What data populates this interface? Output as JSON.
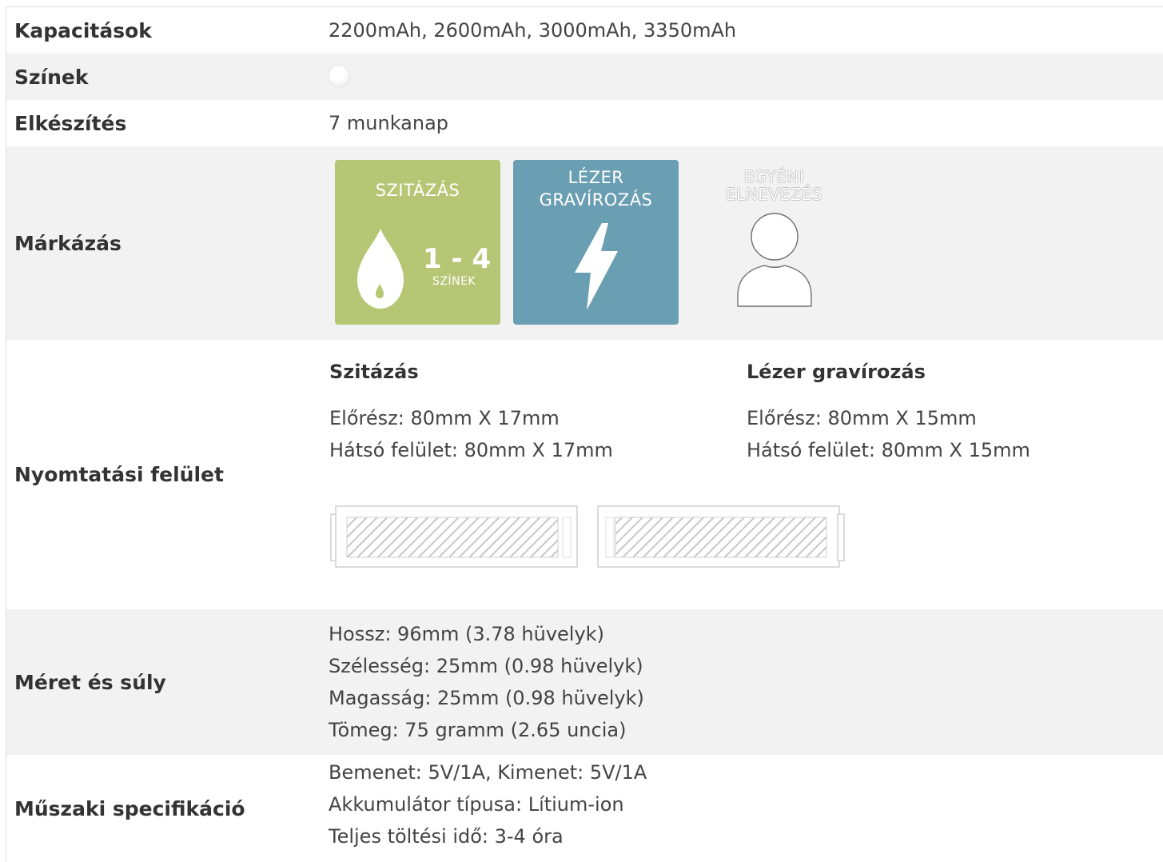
{
  "rows": {
    "capacity": {
      "label": "Kapacitások",
      "value": "2200mAh, 2600mAh, 3000mAh, 3350mAh"
    },
    "colors": {
      "label": "Színek",
      "swatch": "#ffffff"
    },
    "production": {
      "label": "Elkészítés",
      "value": "7 munkanap"
    },
    "branding": {
      "label": "Márkázás",
      "tiles": {
        "screen": {
          "title": "SZITÁZÁS",
          "count": "1 - 4",
          "count_label": "SZÍNEK",
          "color": "#b5c775",
          "icon": "drop-icon"
        },
        "laser": {
          "title_line1": "LÉZER",
          "title_line2": "GRAVÍROZÁS",
          "color": "#6a9fb3",
          "icon": "lightning-icon"
        },
        "custom": {
          "title_line1": "EGYÉNI",
          "title_line2": "ELNEVEZÉS",
          "icon": "person-icon"
        }
      }
    },
    "print_area": {
      "label": "Nyomtatási felület",
      "screen": {
        "heading": "Szitázás",
        "front": "Előrész: 80mm X 17mm",
        "back": "Hátsó felület: 80mm X 17mm"
      },
      "laser": {
        "heading": "Lézer gravírozás",
        "front": "Előrész: 80mm X 15mm",
        "back": "Hátsó felület: 80mm X 15mm"
      }
    },
    "dimensions": {
      "label": "Méret és súly",
      "lines": [
        "Hossz: 96mm (3.78 hüvelyk)",
        "Szélesség: 25mm (0.98 hüvelyk)",
        "Magasság: 25mm (0.98 hüvelyk)",
        "Tömeg: 75 gramm (2.65 uncia)"
      ]
    },
    "specs": {
      "label": "Műszaki specifikáció",
      "lines": [
        "Bemenet: 5V/1A, Kimenet: 5V/1A",
        "Akkumulátor típusa: Lítium-ion",
        "Teljes töltési idő: 3-4 óra"
      ]
    }
  }
}
